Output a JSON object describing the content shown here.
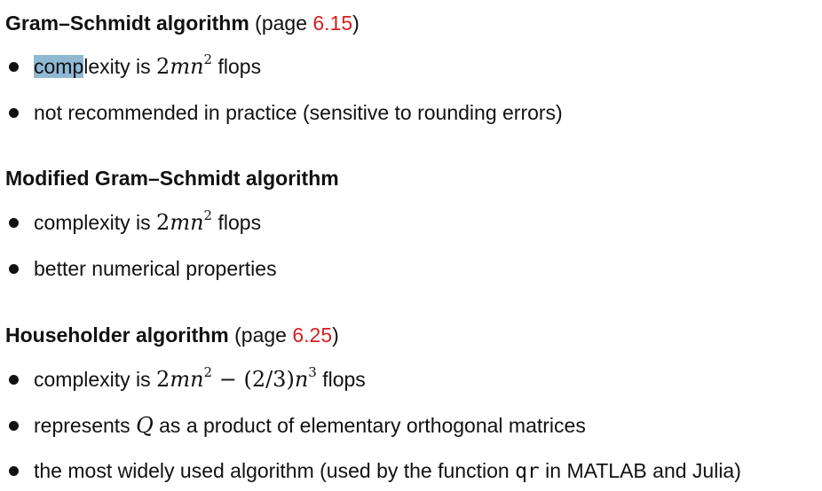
{
  "sections": [
    {
      "title": "Gram–Schmidt algorithm",
      "page_prefix": "(page ",
      "page_ref": "6.15",
      "page_suffix": ")",
      "bullets": [
        {
          "highlight": "comp",
          "text_after_highlight": "lexity is ",
          "math_pre": "2",
          "math_var": "mn",
          "math_exp": "2",
          "text_after": " flops"
        },
        {
          "text": "not recommended in practice (sensitive to rounding errors)"
        }
      ]
    },
    {
      "title": "Modified Gram–Schmidt algorithm",
      "bullets": [
        {
          "text_before": "complexity is ",
          "math_pre": "2",
          "math_var": "mn",
          "math_exp": "2",
          "text_after": " flops"
        },
        {
          "text": "better numerical properties"
        }
      ]
    },
    {
      "title": "Householder algorithm",
      "page_prefix": "(page ",
      "page_ref": "6.25",
      "page_suffix": ")",
      "bullets": [
        {
          "text_before": "complexity is ",
          "math_pre": "2",
          "math_var": "mn",
          "math_exp": "2",
          "math_minus": " − (2/3)",
          "math_var2": "n",
          "math_exp2": "3",
          "text_after": " flops"
        },
        {
          "text_before": "represents ",
          "math_var": "Q",
          "text_after": " as a product of elementary orthogonal matrices"
        },
        {
          "text_before": "the most widely used algorithm (used by the function ",
          "code": "qr",
          "text_after": " in MATLAB and Julia)"
        }
      ]
    }
  ]
}
